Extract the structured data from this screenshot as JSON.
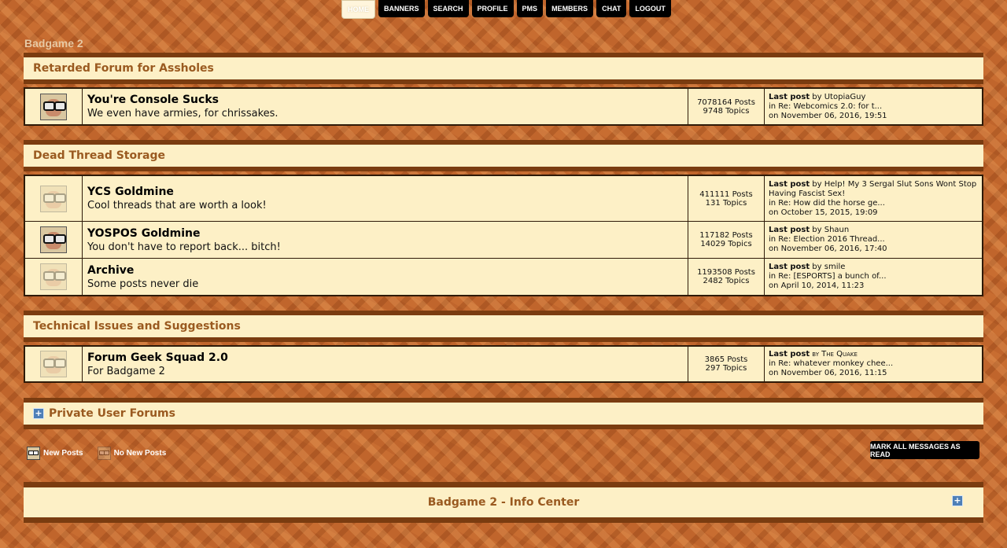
{
  "nav": [
    {
      "label": "HOME"
    },
    {
      "label": "BANNERS"
    },
    {
      "label": "SEARCH"
    },
    {
      "label": "PROFILE"
    },
    {
      "label": "PMS"
    },
    {
      "label": "MEMBERS"
    },
    {
      "label": "CHAT"
    },
    {
      "label": "LOGOUT"
    }
  ],
  "site_title": "Badgame 2",
  "categories": [
    {
      "title": "Retarded Forum for Assholes",
      "boards": [
        {
          "name": "You're Console Sucks",
          "desc": "We even have armies, for chrissakes.",
          "posts": "7078164 Posts",
          "topics": "9748 Topics",
          "lp_label": "Last post",
          "lp_by": "by UtopiaGuy",
          "lp_in": "in Re: Webcomics 2.0: for t...",
          "lp_on": "on November 06, 2016, 19:51",
          "icon": "new-posts-icon"
        }
      ]
    },
    {
      "title": "Dead Thread Storage",
      "boards": [
        {
          "name": "YCS Goldmine",
          "desc": "Cool threads that are worth a look!",
          "posts": "411111 Posts",
          "topics": "131 Topics",
          "lp_label": "Last post",
          "lp_by": "by Help! My 3 Sergal Slut Sons Wont Stop Having Fascist Sex!",
          "lp_in": "in Re: How did the horse ge...",
          "lp_on": "on October 15, 2015, 19:09",
          "icon": "no-new-posts-icon"
        },
        {
          "name": "YOSPOS Goldmine",
          "desc": "You don't have to report back... bitch!",
          "posts": "117182 Posts",
          "topics": "14029 Topics",
          "lp_label": "Last post",
          "lp_by": "by Shaun",
          "lp_in": "in Re: Election 2016 Thread...",
          "lp_on": "on November 06, 2016, 17:40",
          "icon": "new-posts-icon"
        },
        {
          "name": "Archive",
          "desc": "Some posts never die",
          "posts": "1193508 Posts",
          "topics": "2482 Topics",
          "lp_label": "Last post",
          "lp_by": "by smile",
          "lp_in": "in Re: [ESPORTS] a bunch of...",
          "lp_on": "on April 10, 2014, 11:23",
          "icon": "no-new-posts-icon"
        }
      ]
    },
    {
      "title": "Technical Issues and Suggestions",
      "boards": [
        {
          "name": "Forum Geek Squad 2.0",
          "desc": "For Badgame 2",
          "posts": "3865 Posts",
          "topics": "297 Topics",
          "lp_label": "Last post",
          "lp_by": "by The Quake",
          "lp_in": "in Re: whatever monkey chee...",
          "lp_on": "on November 06, 2016, 11:15",
          "icon": "no-new-posts-icon"
        }
      ]
    }
  ],
  "private_forums": {
    "label": "Private User Forums",
    "icon": "expand-plus-icon"
  },
  "legend": {
    "new_posts": "New Posts",
    "no_new_posts": "No New Posts"
  },
  "mark_read": "MARK ALL MESSAGES AS READ",
  "info_center": "Badgame 2 - Info Center",
  "colors": {
    "category_text": "#9a5a20",
    "bar_bg": "#fdf0c6",
    "bar_border": "#7a3c10",
    "button_bg": "#000000"
  }
}
